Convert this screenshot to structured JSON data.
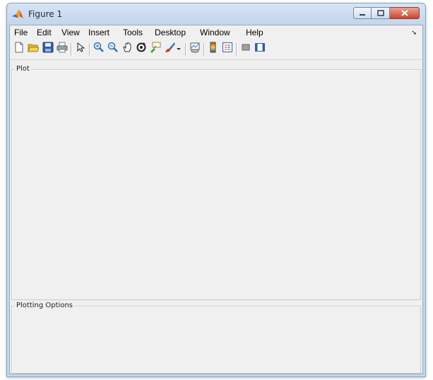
{
  "window": {
    "title": "Figure 1"
  },
  "menu": {
    "items": [
      {
        "label": "File"
      },
      {
        "label": "Edit"
      },
      {
        "label": "View"
      },
      {
        "label": "Insert"
      },
      {
        "label": "Tools"
      },
      {
        "label": "Desktop"
      },
      {
        "label": "Window"
      },
      {
        "label": "Help"
      }
    ],
    "expand_glyph": "➘"
  },
  "toolbar": {
    "buttons": [
      {
        "icon": "new-figure-icon"
      },
      {
        "icon": "open-file-icon"
      },
      {
        "icon": "save-icon"
      },
      {
        "icon": "print-icon"
      },
      {
        "icon": "edit-plot-arrow-icon"
      },
      {
        "icon": "zoom-in-icon"
      },
      {
        "icon": "zoom-out-icon"
      },
      {
        "icon": "pan-hand-icon"
      },
      {
        "icon": "rotate-3d-icon"
      },
      {
        "icon": "data-cursor-icon"
      },
      {
        "icon": "brush-icon"
      },
      {
        "icon": "dropdown-arrow-icon"
      },
      {
        "icon": "link-plot-icon"
      },
      {
        "icon": "insert-colorbar-icon"
      },
      {
        "icon": "insert-legend-icon"
      },
      {
        "icon": "hide-plot-tools-icon"
      },
      {
        "icon": "show-plot-tools-icon"
      }
    ]
  },
  "panels": {
    "plot": {
      "title": "Plot"
    },
    "options": {
      "title": "Plotting Options"
    }
  },
  "colors": {
    "title_gradient": "#c4d6ec",
    "client_bg": "#f0f0f0",
    "close_button": "#c9472d"
  }
}
